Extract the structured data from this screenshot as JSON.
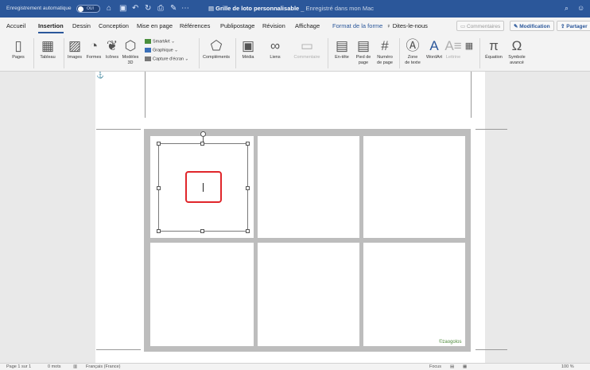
{
  "titlebar": {
    "autosave_label": "Enregistrement automatique",
    "autosave_toggle": "OUI",
    "doc_title": "Grille de loto personnalisable",
    "doc_saved": "_ Enregistré dans mon Mac",
    "icons": [
      "home-icon",
      "save-icon",
      "undo-icon",
      "redo-icon",
      "print-icon",
      "pen-icon",
      "more-icon",
      "search-icon",
      "share-status-icon"
    ]
  },
  "tabs": {
    "items": [
      "Accueil",
      "Insertion",
      "Dessin",
      "Conception",
      "Mise en page",
      "Références",
      "Publipostage",
      "Révision",
      "Affichage",
      "Format de la forme",
      "Dites-le-nous"
    ],
    "active": "Insertion",
    "comments": "Commentaires",
    "edit": "Modification",
    "share": "Partager"
  },
  "ribbon": {
    "pages": "Pages",
    "table": "Tableau",
    "images": "Images",
    "shapes": "Formes",
    "icons": "Icônes",
    "models3d_1": "Modèles",
    "models3d_2": "3D",
    "smartart": "SmartArt",
    "chart": "Graphique",
    "screenshot": "Capture d'écran",
    "addins": "Compléments",
    "media": "Média",
    "links": "Liens",
    "comment": "Commentaire",
    "header": "En-tête",
    "footer_1": "Pied de",
    "footer_2": "page",
    "pagenum_1": "Numéro",
    "pagenum_2": "de page",
    "textbox_1": "Zone",
    "textbox_2": "de texte",
    "wordart": "WordArt",
    "dropcap": "Lettrine",
    "equation": "Équation",
    "symbol_1": "Symbole",
    "symbol_2": "avancé"
  },
  "document": {
    "watermark": "©zaogolos"
  },
  "status": {
    "page": "Page 1 sur 1",
    "words": "0 mots",
    "language": "Français (France)",
    "focus": "Focus",
    "zoom": "100 %"
  },
  "colors": {
    "titlebar": "#2b579a",
    "highlight_box": "#e0262b",
    "grid_gray": "#bdbdbd"
  }
}
